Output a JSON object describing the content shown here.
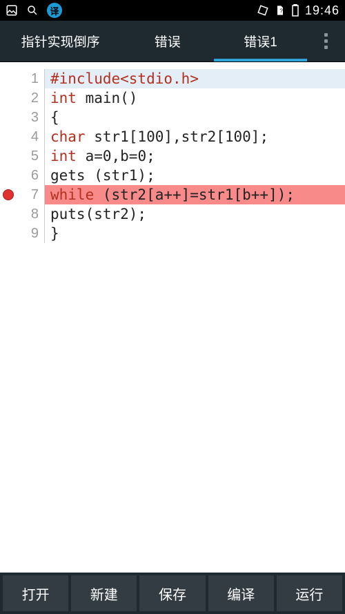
{
  "status": {
    "translate_label": "译",
    "time": "19:46"
  },
  "tabs": {
    "items": [
      {
        "label": "指针实现倒序",
        "active": false
      },
      {
        "label": "错误",
        "active": false
      },
      {
        "label": "错误1",
        "active": true
      }
    ]
  },
  "editor": {
    "lines": [
      {
        "n": "1",
        "breakpoint": false,
        "highlight": "blue",
        "tokens": [
          {
            "t": "#include<stdio.h>",
            "c": "pre"
          }
        ]
      },
      {
        "n": "2",
        "breakpoint": false,
        "highlight": "",
        "tokens": [
          {
            "t": "int",
            "c": "kw"
          },
          {
            "t": " main()",
            "c": "plain"
          }
        ]
      },
      {
        "n": "3",
        "breakpoint": false,
        "highlight": "",
        "tokens": [
          {
            "t": "{",
            "c": "plain"
          }
        ]
      },
      {
        "n": "4",
        "breakpoint": false,
        "highlight": "",
        "tokens": [
          {
            "t": "char",
            "c": "kw"
          },
          {
            "t": " str1[100],str2[100];",
            "c": "plain"
          }
        ]
      },
      {
        "n": "5",
        "breakpoint": false,
        "highlight": "",
        "tokens": [
          {
            "t": "int",
            "c": "kw"
          },
          {
            "t": " a=0,b=0;",
            "c": "plain"
          }
        ]
      },
      {
        "n": "6",
        "breakpoint": false,
        "highlight": "",
        "tokens": [
          {
            "t": "gets (str1);",
            "c": "plain"
          }
        ]
      },
      {
        "n": "7",
        "breakpoint": true,
        "highlight": "red",
        "tokens": [
          {
            "t": "while",
            "c": "kw"
          },
          {
            "t": " (str2[a++]=str1[b++]);",
            "c": "plain"
          }
        ]
      },
      {
        "n": "8",
        "breakpoint": false,
        "highlight": "",
        "tokens": [
          {
            "t": "puts(str2);",
            "c": "plain"
          }
        ]
      },
      {
        "n": "9",
        "breakpoint": false,
        "highlight": "",
        "tokens": [
          {
            "t": "}",
            "c": "plain"
          }
        ]
      }
    ]
  },
  "bottom": {
    "buttons": [
      {
        "label": "打开"
      },
      {
        "label": "新建"
      },
      {
        "label": "保存"
      },
      {
        "label": "编译"
      },
      {
        "label": "运行"
      }
    ]
  },
  "icons": {
    "image": "image-icon",
    "search": "search-icon",
    "rotate": "rotate-icon",
    "sim": "sim-icon",
    "battery": "battery-icon",
    "menu": "menu-icon"
  }
}
